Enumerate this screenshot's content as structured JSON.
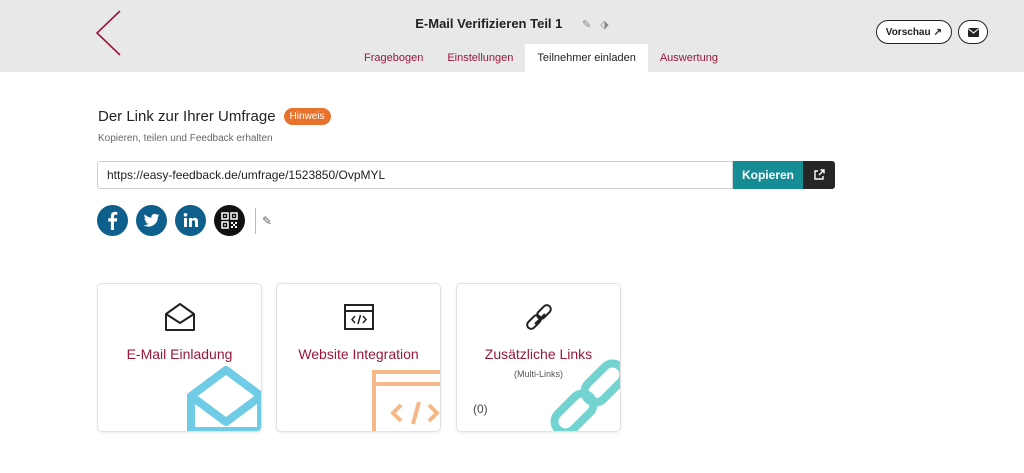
{
  "header": {
    "title": "E-Mail Verifizieren Teil 1",
    "tabs": [
      {
        "label": "Fragebogen"
      },
      {
        "label": "Einstellungen"
      },
      {
        "label": "Teilnehmer einladen"
      },
      {
        "label": "Auswertung"
      }
    ],
    "active_tab": "Teilnehmer einladen",
    "preview_label": "Vorschau"
  },
  "link_section": {
    "title": "Der Link zur Ihrer Umfrage",
    "badge": "Hinweis",
    "subtitle": "Kopieren, teilen und Feedback erhalten",
    "url": "https://easy-feedback.de/umfrage/1523850/OvpMYL",
    "copy_label": "Kopieren"
  },
  "share": {
    "items": [
      "facebook-icon",
      "twitter-icon",
      "linkedin-icon",
      "qr-code-icon"
    ]
  },
  "cards": [
    {
      "title": "E-Mail Einladung",
      "icon": "envelope-open-icon"
    },
    {
      "title": "Website Integration",
      "icon": "code-window-icon"
    },
    {
      "title": "Zusätzliche Links",
      "subtitle": "(Multi-Links)",
      "count": "(0)",
      "icon": "link-icon"
    }
  ],
  "colors": {
    "brand": "#9b1739",
    "badge": "#e8732c",
    "copy_button": "#168d95",
    "deco_blue": "#6fcbe6",
    "deco_orange": "#f7b887",
    "deco_teal": "#73d3d0"
  }
}
